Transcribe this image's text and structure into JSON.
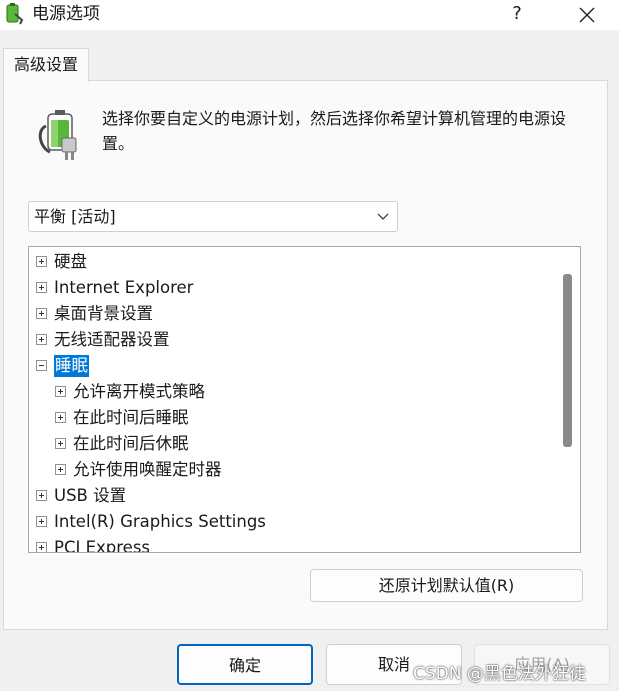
{
  "window": {
    "title": "电源选项",
    "help_label": "?",
    "app_icon": "battery-plug-icon",
    "close_icon": "close-icon"
  },
  "tabs": [
    {
      "label": "高级设置"
    }
  ],
  "intro": {
    "icon": "power-plan-icon",
    "text": "选择你要自定义的电源计划，然后选择你希望计算机管理的电源设置。"
  },
  "plan_select": {
    "value": "平衡 [活动]",
    "icon": "chevron-down-icon"
  },
  "tree": {
    "items": [
      {
        "label": "硬盘",
        "state": "collapsed",
        "level": 0
      },
      {
        "label": "Internet Explorer",
        "state": "collapsed",
        "level": 0
      },
      {
        "label": "桌面背景设置",
        "state": "collapsed",
        "level": 0
      },
      {
        "label": "无线适配器设置",
        "state": "collapsed",
        "level": 0
      },
      {
        "label": "睡眠",
        "state": "expanded",
        "level": 0,
        "selected": true
      },
      {
        "label": "允许离开模式策略",
        "state": "collapsed",
        "level": 1
      },
      {
        "label": "在此时间后睡眠",
        "state": "collapsed",
        "level": 1
      },
      {
        "label": "在此时间后休眠",
        "state": "collapsed",
        "level": 1
      },
      {
        "label": "允许使用唤醒定时器",
        "state": "collapsed",
        "level": 1
      },
      {
        "label": "USB 设置",
        "state": "collapsed",
        "level": 0
      },
      {
        "label": "Intel(R) Graphics Settings",
        "state": "collapsed",
        "level": 0
      },
      {
        "label": "PCI Express",
        "state": "collapsed",
        "level": 0
      }
    ]
  },
  "restore_button": "还原计划默认值(R)",
  "footer": {
    "ok": "确定",
    "cancel": "取消",
    "apply": "应用(A)"
  },
  "watermark": "CSDN @黑色法外狂徒",
  "colors": {
    "selection": "#0078d7",
    "primary_border": "#0067c0",
    "battery_green": "#4caf32"
  }
}
